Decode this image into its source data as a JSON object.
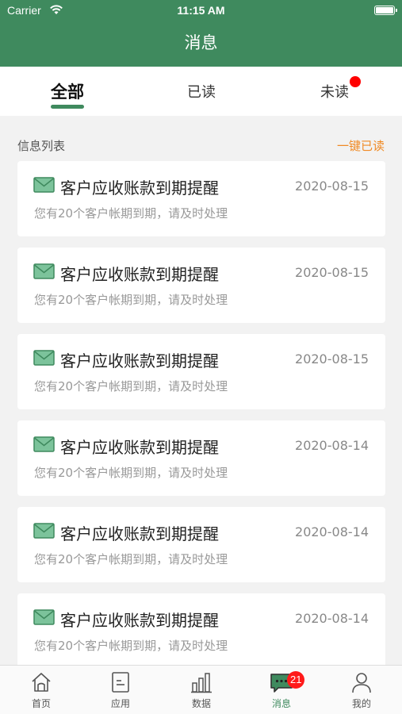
{
  "status_bar": {
    "carrier": "Carrier",
    "time": "11:15 AM"
  },
  "nav": {
    "title": "消息"
  },
  "tabs": [
    {
      "label": "全部",
      "active": true
    },
    {
      "label": "已读",
      "active": false
    },
    {
      "label": "未读",
      "active": false,
      "has_dot": true
    }
  ],
  "section": {
    "title": "信息列表",
    "action": "一键已读"
  },
  "messages": [
    {
      "title": "客户应收账款到期提醒",
      "date": "2020-08-15",
      "desc": "您有20个客户帐期到期，请及时处理"
    },
    {
      "title": "客户应收账款到期提醒",
      "date": "2020-08-15",
      "desc": "您有20个客户帐期到期，请及时处理"
    },
    {
      "title": "客户应收账款到期提醒",
      "date": "2020-08-15",
      "desc": "您有20个客户帐期到期，请及时处理"
    },
    {
      "title": "客户应收账款到期提醒",
      "date": "2020-08-14",
      "desc": "您有20个客户帐期到期，请及时处理"
    },
    {
      "title": "客户应收账款到期提醒",
      "date": "2020-08-14",
      "desc": "您有20个客户帐期到期，请及时处理"
    },
    {
      "title": "客户应收账款到期提醒",
      "date": "2020-08-14",
      "desc": "您有20个客户帐期到期，请及时处理"
    }
  ],
  "tabbar": [
    {
      "label": "首页",
      "icon": "home-icon",
      "active": false
    },
    {
      "label": "应用",
      "icon": "app-icon",
      "active": false
    },
    {
      "label": "数据",
      "icon": "chart-icon",
      "active": false
    },
    {
      "label": "消息",
      "icon": "message-icon",
      "active": true,
      "badge": "21"
    },
    {
      "label": "我的",
      "icon": "user-icon",
      "active": false
    }
  ],
  "colors": {
    "primary": "#3f8a5e",
    "accent": "#f08a24",
    "badge": "#ff1a1a"
  }
}
